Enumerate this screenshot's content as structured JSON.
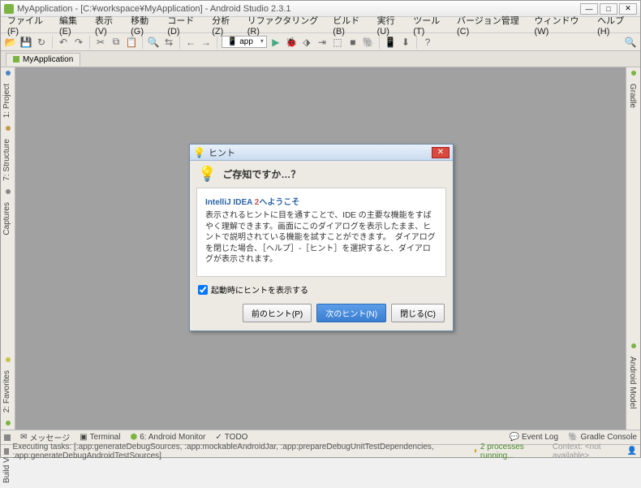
{
  "window": {
    "title": "MyApplication - [C:¥workspace¥MyApplication] - Android Studio 2.3.1"
  },
  "menu": {
    "file": "ファイル(F)",
    "edit": "編集(E)",
    "view": "表示(V)",
    "navigate": "移動(G)",
    "code": "コード(D)",
    "analyze": "分析(Z)",
    "refactor": "リファクタリング(R)",
    "build": "ビルド(B)",
    "run": "実行(U)",
    "tools": "ツール(T)",
    "vcs": "バージョン管理(C)",
    "window": "ウィンドウ(W)",
    "help": "ヘルプ(H)"
  },
  "toolbar": {
    "run_target": "app"
  },
  "nav": {
    "breadcrumb": "MyApplication"
  },
  "left_tabs": {
    "project": "1: Project",
    "structure": "7: Structure",
    "captures": "Captures",
    "favorites": "2: Favorites",
    "build_variants": "Build Variants"
  },
  "right_tabs": {
    "gradle": "Gradle",
    "model": "Android Model"
  },
  "bottom_tabs": {
    "messages": "メッセージ",
    "terminal": "Terminal",
    "monitor": "6: Android Monitor",
    "todo": "TODO",
    "eventlog": "Event Log",
    "gradle_console": "Gradle Console"
  },
  "status": {
    "task": "Executing tasks: [:app:generateDebugSources, :app:mockableAndroidJar, :app:prepareDebugUnitTestDependencies, :app:generateDebugAndroidTestSources]",
    "running": "2 processes running...",
    "context": "Context: <not available>"
  },
  "dialog": {
    "title": "ヒント",
    "heading": "ご存知ですか…？",
    "welcome_prefix": "IntelliJ IDEA ",
    "welcome_two": "2",
    "welcome_suffix": "へようこそ",
    "body": "表示されるヒントに目を通すことで、IDE の主要な機能をすばやく理解できます。画面にこのダイアログを表示したまま、ヒントで説明されている機能を試すことができます。　ダイアログを閉じた場合、［ヘルプ］-［ヒント］を選択すると、ダイアログが表示されます。",
    "show_tips": "起動時にヒントを表示する",
    "prev": "前のヒント(P)",
    "next": "次のヒント(N)",
    "close": "閉じる(C)"
  }
}
